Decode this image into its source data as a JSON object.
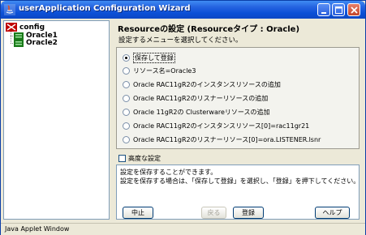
{
  "window": {
    "title": "userApplication Configuration Wizard"
  },
  "tree": {
    "root": "config",
    "children": [
      "Oracle1",
      "Oracle2"
    ]
  },
  "panel": {
    "heading": "Resourceの設定 (Resourceタイプ : Oracle)",
    "instruction": "設定するメニューを選択してください。",
    "options": [
      "保存して登録",
      "リソース名=Oracle3",
      "Oracle RAC11gR2のインスタンスリソースの追加",
      "Oracle RAC11gR2のリスナーリソースの追加",
      "Oracle 11gR2の Clusterwareリソースの追加",
      "Oracle RAC11gR2のインスタンスリソース[0]=rac11gr21",
      "Oracle RAC11gR2のリスナーリソース[0]=ora.LISTENER.lsnr"
    ],
    "selected_index": 0,
    "advanced_label": "高度な設定",
    "description_lines": [
      "設定を保存することができます。",
      "設定を保存する場合は、「保存して登録」を選択し、「登録」を押下してください。"
    ]
  },
  "buttons": {
    "cancel": "中止",
    "back": "戻る",
    "register": "登録",
    "help": "ヘルプ"
  },
  "status": "Java Applet Window"
}
